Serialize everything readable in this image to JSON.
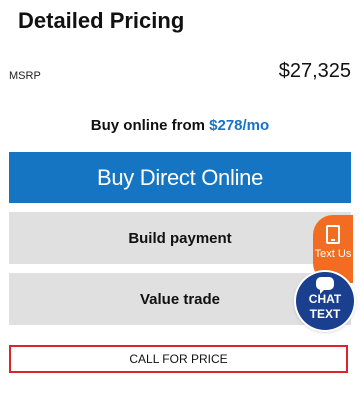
{
  "header": {
    "title": "Detailed Pricing"
  },
  "msrp": {
    "label": "MSRP",
    "value": "$27,325"
  },
  "financing": {
    "prefix": "Buy online from ",
    "price": "$278/mo"
  },
  "buttons": {
    "buy_direct": "Buy Direct Online",
    "build_payment": "Build payment",
    "value_trade": "Value trade",
    "call_for_price": "CALL FOR PRICE"
  },
  "widgets": {
    "text_us": "Text Us",
    "chat_line1": "CHAT",
    "chat_line2": "TEXT"
  },
  "colors": {
    "primary_blue": "#1575c2",
    "price_blue": "#1a73c2",
    "button_gray": "#e0e0e0",
    "call_border_red": "#d9262b",
    "text_us_orange": "#f26d21",
    "chat_navy": "#1b3f8f"
  },
  "icons": {
    "text_us": "phone-icon",
    "chat": "chat-bubble-icon"
  }
}
